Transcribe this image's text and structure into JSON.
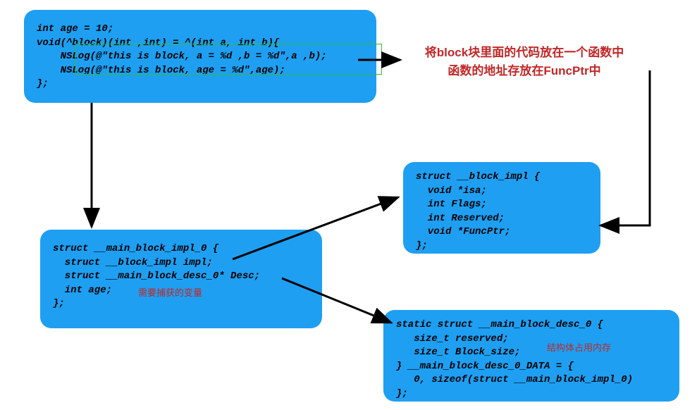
{
  "box_top": {
    "line1": "int age = 10;",
    "line2": "void(^block)(int ,int) = ^(int a, int b){",
    "line3": "    NSLog(@\"this is block, a = %d ,b = %d\",a ,b);",
    "line4": "    NSLog(@\"this is block, age = %d\",age);",
    "line5": "};"
  },
  "box_left": {
    "line1": "struct __main_block_impl_0 {",
    "line2": "  struct __block_impl impl;",
    "line3": "  struct __main_block_desc_0* Desc;",
    "line4": "  int age;",
    "line5": "};"
  },
  "box_right_top": {
    "line1": "struct __block_impl {",
    "line2": "  void *isa;",
    "line3": "  int Flags;",
    "line4": "  int Reserved;",
    "line5": "  void *FuncPtr;",
    "line6": "};"
  },
  "box_right_bottom": {
    "line1": "static struct __main_block_desc_0 {",
    "line2": "   size_t reserved;",
    "line3": "   size_t Block_size;",
    "line4": "} __main_block_desc_0_DATA = {",
    "line5": "   0, sizeof(struct __main_block_impl_0)",
    "line6": "};"
  },
  "annotation_main": {
    "line1": "将block块里面的代码放在一个函数中",
    "line2": "函数的地址存放在FuncPtr中"
  },
  "annotation_capture": "需要捕获的变量",
  "annotation_memory": "结构体占用内存"
}
